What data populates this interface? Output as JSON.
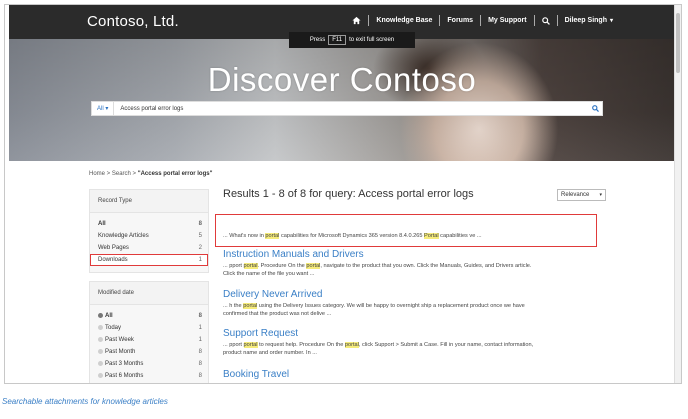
{
  "header": {
    "brand": "Contoso, Ltd.",
    "nav": [
      "Knowledge Base",
      "Forums",
      "My Support"
    ],
    "user": "Dileep Singh"
  },
  "fullscreen_notice": {
    "prefix": "Press",
    "key": "F11",
    "suffix": "to exit full screen"
  },
  "hero": {
    "title": "Discover Contoso",
    "search_scope": "All",
    "search_query": "Access portal error logs"
  },
  "breadcrumb": {
    "home": "Home",
    "search": "Search",
    "current": "\"Access portal error logs\""
  },
  "record_type": {
    "title": "Record Type",
    "items": [
      {
        "label": "All",
        "count": "8"
      },
      {
        "label": "Knowledge Articles",
        "count": "5"
      },
      {
        "label": "Web Pages",
        "count": "2"
      },
      {
        "label": "Downloads",
        "count": "1"
      }
    ]
  },
  "modified_date": {
    "title": "Modified date",
    "items": [
      {
        "label": "All",
        "count": "8"
      },
      {
        "label": "Today",
        "count": "1"
      },
      {
        "label": "Past Week",
        "count": "1"
      },
      {
        "label": "Past Month",
        "count": "8"
      },
      {
        "label": "Past 3 Months",
        "count": "8"
      },
      {
        "label": "Past 6 Months",
        "count": "8"
      }
    ]
  },
  "results": {
    "heading": "Results 1 - 8 of 8 for query: Access portal error logs",
    "sort": "Relevance",
    "items": [
      {
        "title": "",
        "s1a": "... What's now in ",
        "s1h": "portal",
        "s1b": " capabilities for Microsoft Dynamics 365 version 8.4.0.265 ",
        "s1h2": "Portal",
        "s1c": " capabilities ve ..."
      },
      {
        "title": "Instruction Manuals and Drivers",
        "s1a": "... pport ",
        "s1h": "portal",
        "s1b": ". Procedure On the ",
        "s1h2": "portal",
        "s1c": ", navigate to the product that you own. Click the Manuals, Guides, and Drivers article.",
        "s2": "Click the name of the file you want ..."
      },
      {
        "title": "Delivery Never Arrived",
        "s1a": "... h the ",
        "s1h": "portal",
        "s1b": " using the Delivery Issues category. We will be happy to overnight ship a replacement product once we have",
        "s1h2": "",
        "s1c": "",
        "s2": "confirmed that the product was not delive ..."
      },
      {
        "title": "Support Request",
        "s1a": "... pport ",
        "s1h": "portal",
        "s1b": " to request help. Procedure On the ",
        "s1h2": "portal",
        "s1c": ", click Support > Submit a Case. Fill in your name, contact information,",
        "s2": "product name and order number. In ..."
      },
      {
        "title": "Booking Travel"
      }
    ]
  },
  "caption": "Searchable attachments for knowledge articles",
  "colors": {
    "accent": "#3a7fc6",
    "highlight": "#f5eb7a",
    "callout": "#e03a3a",
    "navbar": "#2b2b2b"
  },
  "icons": [
    "home-icon",
    "search-icon",
    "chevron-down-icon",
    "radio-icon"
  ]
}
